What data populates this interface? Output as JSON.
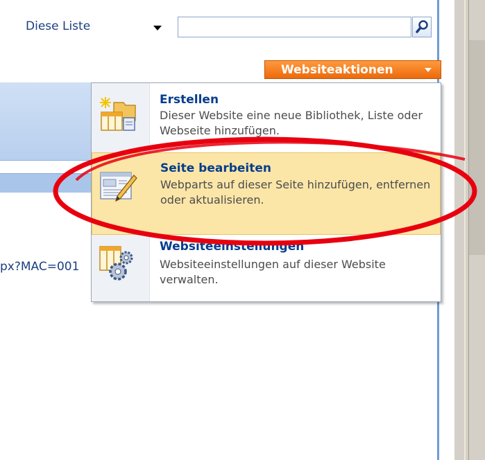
{
  "search": {
    "scope_value": "Diese Liste",
    "query_value": ""
  },
  "site_actions": {
    "label": "Websiteaktionen"
  },
  "background": {
    "url_fragment": "px?MAC=001"
  },
  "menu": {
    "items": [
      {
        "title": "Erstellen",
        "description": "Dieser Website eine neue Bibliothek, Liste oder Webseite hinzufügen.",
        "icon": "create-icon"
      },
      {
        "title": "Seite bearbeiten",
        "description": "Webparts auf dieser Seite hinzufügen, entfernen oder aktualisieren.",
        "icon": "edit-page-icon"
      },
      {
        "title": "Websiteeinstellungen",
        "description": "Websiteeinstellungen auf dieser Website verwalten.",
        "icon": "site-settings-icon"
      }
    ]
  },
  "colors": {
    "site_actions_bg": "#ec6a0c",
    "highlight_bg": "#fbe6a8",
    "title_text": "#063d8c",
    "annotation": "#e8000f"
  }
}
